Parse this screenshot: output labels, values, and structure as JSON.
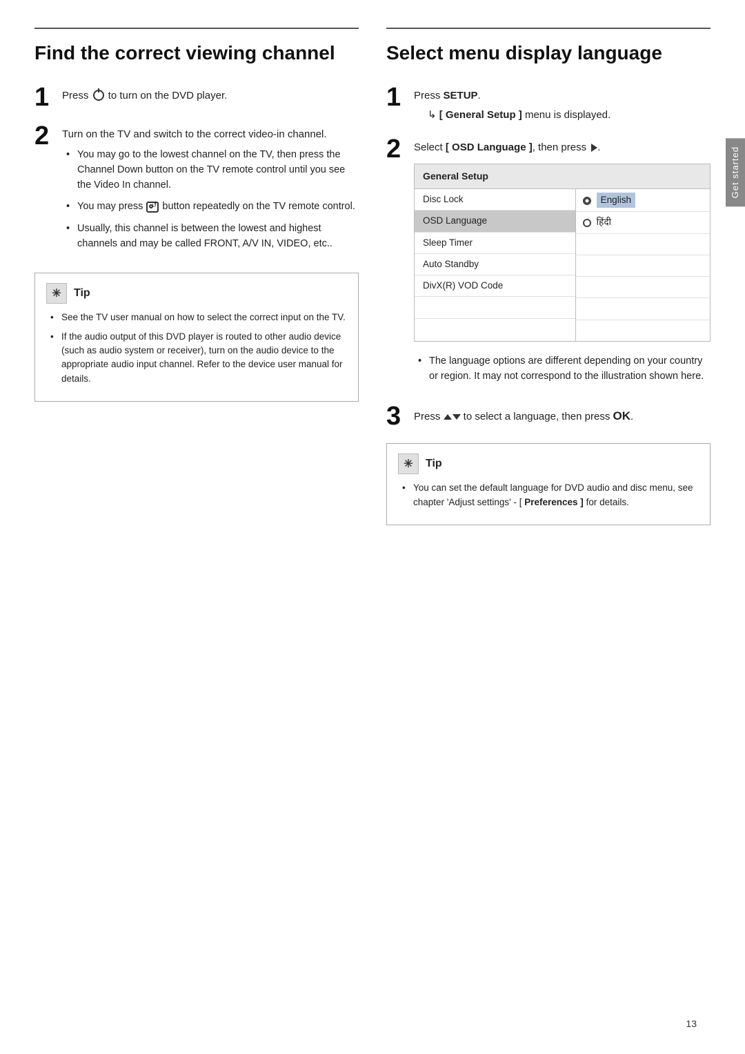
{
  "left": {
    "title": "Find the correct viewing channel",
    "step1": {
      "number": "1",
      "text": "Press ",
      "power_symbol": "⏻",
      "text_after": " to turn on the DVD player."
    },
    "step2": {
      "number": "2",
      "text": "Turn on the TV and switch to the correct video-in channel.",
      "bullets": [
        "You may go to the lowest channel on the TV, then press the Channel Down button on the TV remote control until you see the Video In channel.",
        "You may press  button repeatedly on the TV remote control.",
        "Usually, this channel is between the lowest and highest channels and may be called FRONT, A/V IN, VIDEO, etc.."
      ]
    },
    "tip": {
      "label": "Tip",
      "bullets": [
        "See the TV user manual on how to select the correct input on the TV.",
        "If the audio output of this DVD player is routed to other audio device (such as audio system or receiver), turn on the audio device to the appropriate audio input channel. Refer to the device user manual for details."
      ]
    }
  },
  "right": {
    "title": "Select menu display language",
    "step1": {
      "number": "1",
      "text": "Press ",
      "setup_bold": "SETUP",
      "indent": "↳ [ General Setup ] menu is displayed."
    },
    "step2": {
      "number": "2",
      "text_before": "Select ",
      "osd_bracket": "[ OSD Language ]",
      "text_after": ", then press"
    },
    "table": {
      "header": "General Setup",
      "left_items": [
        {
          "label": "Disc Lock",
          "active": false
        },
        {
          "label": "OSD Language",
          "active": true
        },
        {
          "label": "Sleep Timer",
          "active": false
        },
        {
          "label": "Auto Standby",
          "active": false
        },
        {
          "label": "DivX(R)  VOD Code",
          "active": false
        },
        {
          "label": "",
          "active": false
        },
        {
          "label": "",
          "active": false
        }
      ],
      "right_items": [
        {
          "label": "English",
          "selected": true
        },
        {
          "label": "हिंदी",
          "selected": false
        },
        {
          "label": "",
          "selected": false
        },
        {
          "label": "",
          "selected": false
        },
        {
          "label": "",
          "selected": false
        },
        {
          "label": "",
          "selected": false
        },
        {
          "label": "",
          "selected": false
        }
      ]
    },
    "note_bullets": [
      "The language options are different depending on your country or region. It may not correspond to the illustration shown here."
    ],
    "step3": {
      "number": "3",
      "text": "Press ▲▼ to select a language, then press",
      "ok": "OK."
    },
    "tip": {
      "label": "Tip",
      "text": "You can set the default language for DVD audio and disc menu, see chapter 'Adjust settings' - [",
      "preferences": "Preferences ]",
      "text_after": " for details."
    }
  },
  "sidebar": {
    "label": "Get started"
  },
  "page_number": "13"
}
